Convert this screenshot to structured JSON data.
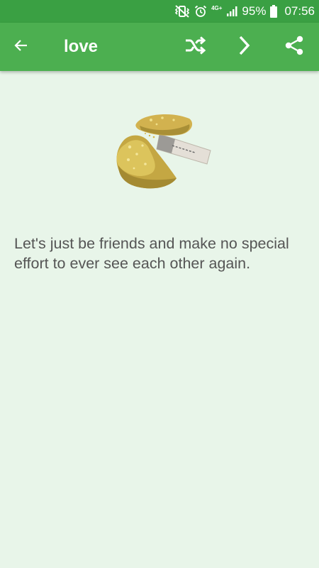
{
  "status_bar": {
    "network_label": "4G+",
    "battery_percent": "95%",
    "time": "07:56",
    "icons": [
      "vibrate-mute-icon",
      "alarm-icon",
      "network-4g-icon",
      "signal-icon",
      "battery-icon"
    ]
  },
  "toolbar": {
    "title": "love",
    "icons": [
      "back-arrow-icon",
      "shuffle-icon",
      "chevron-right-icon",
      "share-icon"
    ]
  },
  "fortune": {
    "text": "Let's just be friends and make no special effort to ever see each other again.",
    "image_icon": "fortune-cookie-icon"
  },
  "colors": {
    "status_bar": "#3aa043",
    "app_bar": "#4caf50",
    "background": "#e8f5e9",
    "text": "#555555"
  }
}
